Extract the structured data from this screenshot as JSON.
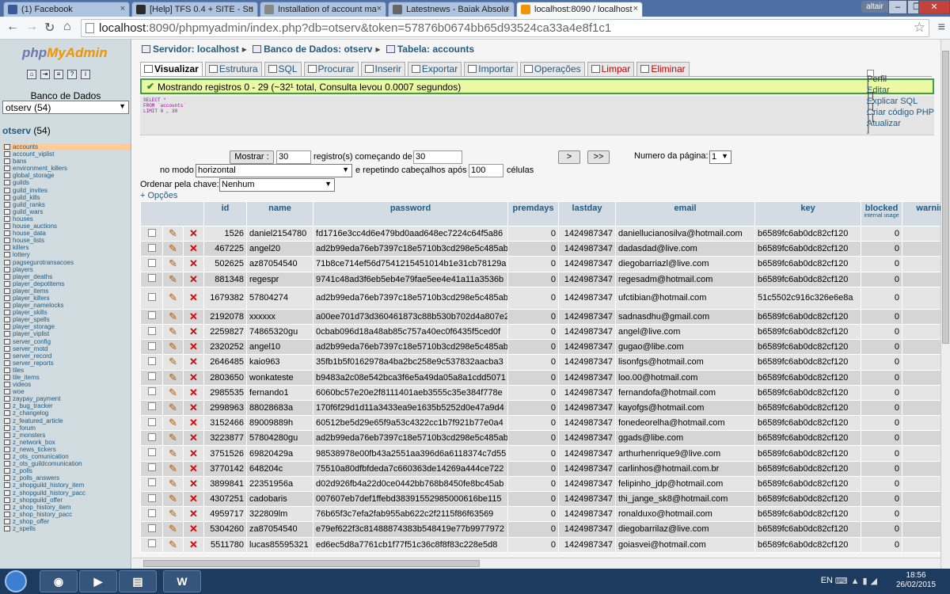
{
  "browser": {
    "tabs": [
      {
        "title": "(1) Facebook",
        "color": "#3b5998"
      },
      {
        "title": "[Help] TFS 0.4 + SITE - Su",
        "color": "#2b2b2b"
      },
      {
        "title": "Installation of account ma",
        "color": "#888888"
      },
      {
        "title": "Latestnews - Baiak Absolu",
        "color": "#666666"
      },
      {
        "title": "localhost:8090 / localhost",
        "color": "#f29300"
      }
    ],
    "user": "altair",
    "url_host": "localhost",
    "url_path": ":8090/phpmyadmin/index.php?db=otserv&token=57876b0674bb65d93524ca33a4e8f1c1"
  },
  "sidebar": {
    "logo_php": "php",
    "logo_myadmin": "MyAdmin",
    "db_label": "Banco de Dados",
    "db_select": "otserv (54)",
    "db_name": "otserv",
    "db_count": "(54)",
    "tables": [
      "accounts",
      "account_viplist",
      "bans",
      "environment_killers",
      "global_storage",
      "guilds",
      "guild_invites",
      "guild_kills",
      "guild_ranks",
      "guild_wars",
      "houses",
      "house_auctions",
      "house_data",
      "house_lists",
      "killers",
      "lottery",
      "pagsegurotransacoes",
      "players",
      "player_deaths",
      "player_depotitems",
      "player_items",
      "player_killers",
      "player_namelocks",
      "player_skills",
      "player_spells",
      "player_storage",
      "player_viplist",
      "server_config",
      "server_motd",
      "server_record",
      "server_reports",
      "tiles",
      "tile_items",
      "videos",
      "woe",
      "zaypay_payment",
      "z_bug_tracker",
      "z_changelog",
      "z_featured_article",
      "z_forum",
      "z_monsters",
      "z_network_box",
      "z_news_tickers",
      "z_ots_comunication",
      "z_ots_guildcomunication",
      "z_polls",
      "z_polls_answers",
      "z_shopguild_history_item",
      "z_shopguild_history_pacc",
      "z_shopguild_offer",
      "z_shop_history_item",
      "z_shop_history_pacc",
      "z_shop_offer",
      "z_spells"
    ]
  },
  "main": {
    "breadcrumb": {
      "server_label": "Servidor:",
      "server": "localhost",
      "db_label": "Banco de Dados:",
      "db": "otserv",
      "table_label": "Tabela:",
      "table": "accounts"
    },
    "tabs": [
      "Visualizar",
      "Estrutura",
      "SQL",
      "Procurar",
      "Inserir",
      "Exportar",
      "Importar",
      "Operações",
      "Limpar",
      "Eliminar"
    ],
    "success": "Mostrando registros 0 - 29 (~32¹ total, Consulta levou 0.0007 segundos)",
    "sql": [
      "SELECT *",
      "FROM `accounts`",
      "LIMIT 0 , 30"
    ],
    "sql_links": {
      "perfil": "Perfil",
      "editar": "Editar",
      "explicar": "Explicar SQL",
      "criar": "Criar código PHP",
      "atualizar": "Atualizar"
    },
    "nav": {
      "mostrar": "Mostrar :",
      "rows_value": "30",
      "registros": "registro(s) começando de",
      "start_value": "30",
      "next": ">",
      "last": ">>",
      "page_label": "Numero da página:",
      "page_value": "1",
      "modo_label": "no modo",
      "modo_value": "horizontal",
      "repetindo": "e repetindo cabeçalhos após",
      "repeat_value": "100",
      "celulas": "células",
      "ordenar_label": "Ordenar pela chave:",
      "ordenar_value": "Nenhum",
      "opcoes": "+ Opções"
    },
    "columns": [
      "id",
      "name",
      "password",
      "premdays",
      "lastday",
      "email",
      "key",
      "blocked",
      "warning"
    ],
    "blocked_sub": "internal usage",
    "rows": [
      [
        "1526",
        "daniel2154780",
        "fd1716e3cc4d6e479bd0aad648ec7224c64f5a86",
        "0",
        "1424987347",
        "daniellucianosilva@hotmail.com",
        "b6589fc6ab0dc82cf120",
        "0"
      ],
      [
        "467225",
        "angel20",
        "ad2b99eda76eb7397c18e5710b3cd298e5c485ab",
        "0",
        "1424987347",
        "dadasdad@live.com",
        "b6589fc6ab0dc82cf120",
        "0"
      ],
      [
        "502625",
        "az87054540",
        "71b8ce714ef56d7541215451014b1e31cb78129a",
        "0",
        "1424987347",
        "diegobarriazl@live.com",
        "b6589fc6ab0dc82cf120",
        "0"
      ],
      [
        "881348",
        "regespr",
        "9741c48ad3f6eb5eb4e79fae5ee4e41a11a3536b",
        "0",
        "1424987347",
        "regesadm@hotmail.com",
        "b6589fc6ab0dc82cf120",
        "0"
      ],
      [
        "1679382",
        "57804274",
        "ad2b99eda76eb7397c18e5710b3cd298e5c485ab",
        "0",
        "1424987347",
        "ufctibian@hotmail.com",
        "51c5502c916c326e6e8a",
        "0"
      ],
      [
        "2192078",
        "xxxxxx",
        "a00ee701d73d360461873c88b530b702d4a807e2",
        "0",
        "1424987347",
        "sadnasdhu@gmail.com",
        "b6589fc6ab0dc82cf120",
        "0"
      ],
      [
        "2259827",
        "74865320gu",
        "0cbab096d18a48ab85c757a40ec0f6435f5ced0f",
        "0",
        "1424987347",
        "angel@live.com",
        "b6589fc6ab0dc82cf120",
        "0"
      ],
      [
        "2320252",
        "angel10",
        "ad2b99eda76eb7397c18e5710b3cd298e5c485ab",
        "0",
        "1424987347",
        "gugao@libe.com",
        "b6589fc6ab0dc82cf120",
        "0"
      ],
      [
        "2646485",
        "kaio963",
        "35fb1b5f0162978a4ba2bc258e9c537832aacba3",
        "0",
        "1424987347",
        "lisonfgs@hotmail.com",
        "b6589fc6ab0dc82cf120",
        "0"
      ],
      [
        "2803650",
        "wonkateste",
        "b9483a2c08e542bca3f6e5a49da05a8a1cdd5071",
        "0",
        "1424987347",
        "loo.00@hotmail.com",
        "b6589fc6ab0dc82cf120",
        "0"
      ],
      [
        "2985535",
        "fernando1",
        "6060bc57e20e2f8111401aeb3555c35e384f778e",
        "0",
        "1424987347",
        "fernandofa@hotmail.com",
        "b6589fc6ab0dc82cf120",
        "0"
      ],
      [
        "2998963",
        "88028683a",
        "170f6f29d1d11a3433ea9e1635b5252d0e47a9d4",
        "0",
        "1424987347",
        "kayofgs@hotmail.com",
        "b6589fc6ab0dc82cf120",
        "0"
      ],
      [
        "3152466",
        "89009889h",
        "60512be5d29e65f9a53c4322cc1b7f921b77e0a4",
        "0",
        "1424987347",
        "fonedeorelha@hotmail.com",
        "b6589fc6ab0dc82cf120",
        "0"
      ],
      [
        "3223877",
        "57804280gu",
        "ad2b99eda76eb7397c18e5710b3cd298e5c485ab",
        "0",
        "1424987347",
        "ggads@libe.com",
        "b6589fc6ab0dc82cf120",
        "0"
      ],
      [
        "3751526",
        "69820429a",
        "98538978e00fb43a2551aa396d6a6118374c7d55",
        "0",
        "1424987347",
        "arthurhenrique9@live.com",
        "b6589fc6ab0dc82cf120",
        "0"
      ],
      [
        "3770142",
        "648204c",
        "75510a80dfbfdeda7c660363de14269a444ce722",
        "0",
        "1424987347",
        "carlinhos@hotmail.com.br",
        "b6589fc6ab0dc82cf120",
        "0"
      ],
      [
        "3899841",
        "22351956a",
        "d02d926fb4a22d0ce0442bb768b8450fe8bc45ab",
        "0",
        "1424987347",
        "felipinho_jdp@hotmail.com",
        "b6589fc6ab0dc82cf120",
        "0"
      ],
      [
        "4307251",
        "cadobaris",
        "007607eb7def1ffebd38391552985000616be115",
        "0",
        "1424987347",
        "thi_jange_sk8@hotmail.com",
        "b6589fc6ab0dc82cf120",
        "0"
      ],
      [
        "4959717",
        "322809lm",
        "76b65f3c7efa2fab955ab622c2f2115f86f63569",
        "0",
        "1424987347",
        "ronalduxo@hotmail.com",
        "b6589fc6ab0dc82cf120",
        "0"
      ],
      [
        "5304260",
        "za87054540",
        "e79ef622f3c81488874383b548419e77b9977972",
        "0",
        "1424987347",
        "diegobarrilaz@live.com",
        "b6589fc6ab0dc82cf120",
        "0"
      ],
      [
        "5511780",
        "lucas85595321",
        "ed6ec5d8a7761cb1f77f51c36c8f8f83c228e5d8",
        "0",
        "1424987347",
        "goiasvei@hotmail.com",
        "b6589fc6ab0dc82cf120",
        "0"
      ]
    ]
  },
  "taskbar": {
    "lang": "EN",
    "time": "18:56",
    "date": "26/02/2015",
    "word_label": "W"
  }
}
